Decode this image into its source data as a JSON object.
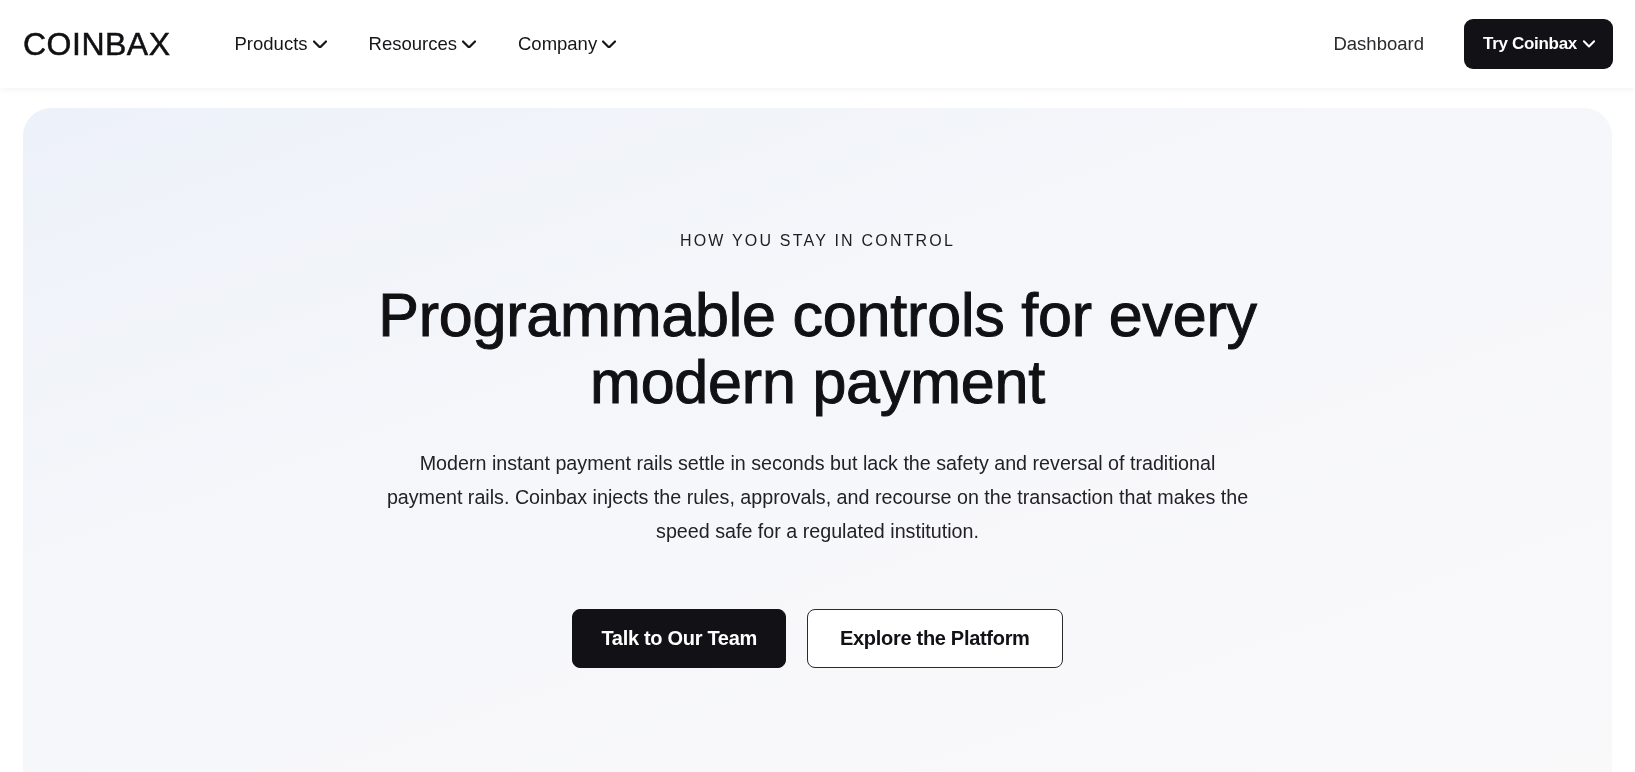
{
  "header": {
    "logo": "COINBAX",
    "nav": [
      {
        "label": "Products",
        "kind": "dropdown"
      },
      {
        "label": "Resources",
        "kind": "dropdown"
      },
      {
        "label": "Company",
        "kind": "dropdown"
      }
    ],
    "actions": [
      {
        "label": "Dashboard",
        "kind": "link"
      },
      {
        "label": "Try Coinbax",
        "kind": "menu_button"
      }
    ]
  },
  "hero": {
    "eyebrow": "HOW YOU STAY IN CONTROL",
    "title": "Programmable controls for every modern payment",
    "description": "Modern instant payment rails settle in seconds but lack the safety and reversal of traditional payment rails. Coinbax injects the rules, approvals, and recourse on the transaction that makes the speed safe for a regulated institution.",
    "buttons": [
      {
        "label": "Talk to Our Team",
        "kind": "primary"
      },
      {
        "label": "Explore the Platform",
        "kind": "secondary"
      }
    ]
  }
}
